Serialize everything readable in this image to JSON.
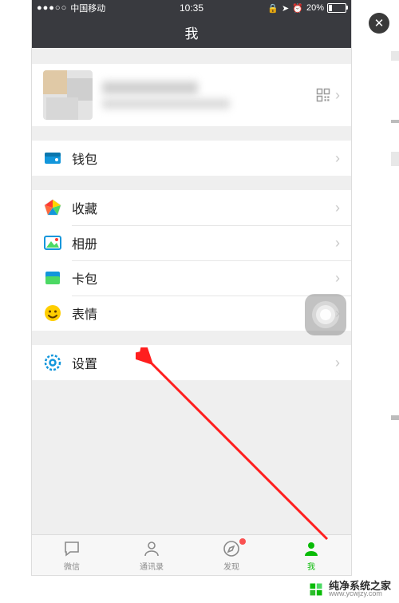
{
  "statusbar": {
    "signal_dots": "●●●○○",
    "carrier": "中国移动",
    "time": "10:35",
    "battery_pct": "20%"
  },
  "nav": {
    "title": "我"
  },
  "close_glyph": "✕",
  "profile": {
    "qr_label": "qr"
  },
  "menu": {
    "wallet": "钱包",
    "favorites": "收藏",
    "album": "相册",
    "cards": "卡包",
    "stickers": "表情",
    "settings": "设置"
  },
  "tabs": {
    "chat": "微信",
    "contacts": "通讯录",
    "discover": "发现",
    "me": "我"
  },
  "brand": {
    "name": "纯净系统之家",
    "url": "www.ycwjzy.com"
  },
  "colors": {
    "accent": "#09bb07",
    "header": "#393a3f",
    "arrow": "#ff1e1e"
  }
}
